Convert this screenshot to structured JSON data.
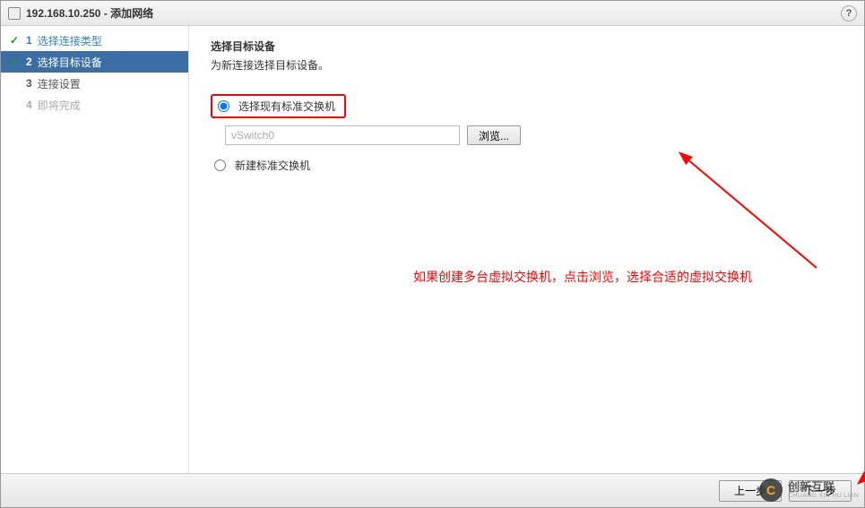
{
  "title": "192.168.10.250 - 添加网络",
  "steps": [
    {
      "num": "1",
      "label": "选择连接类型",
      "state": "completed"
    },
    {
      "num": "2",
      "label": "选择目标设备",
      "state": "active"
    },
    {
      "num": "3",
      "label": "连接设置",
      "state": "upcoming"
    },
    {
      "num": "4",
      "label": "即将完成",
      "state": "disabled"
    }
  ],
  "main": {
    "heading": "选择目标设备",
    "subheading": "为新连接选择目标设备。",
    "radio_existing": "选择现有标准交换机",
    "switch_value": "vSwitch0",
    "browse_label": "浏览...",
    "radio_new": "新建标准交换机"
  },
  "annotation_text": "如果创建多台虚拟交换机，点击浏览，选择合适的虚拟交换机",
  "footer": {
    "prev": "上一步",
    "next": "下一步"
  },
  "watermark": {
    "main": "创新互联",
    "sub": "CHUANG XIN HU LIAN"
  }
}
